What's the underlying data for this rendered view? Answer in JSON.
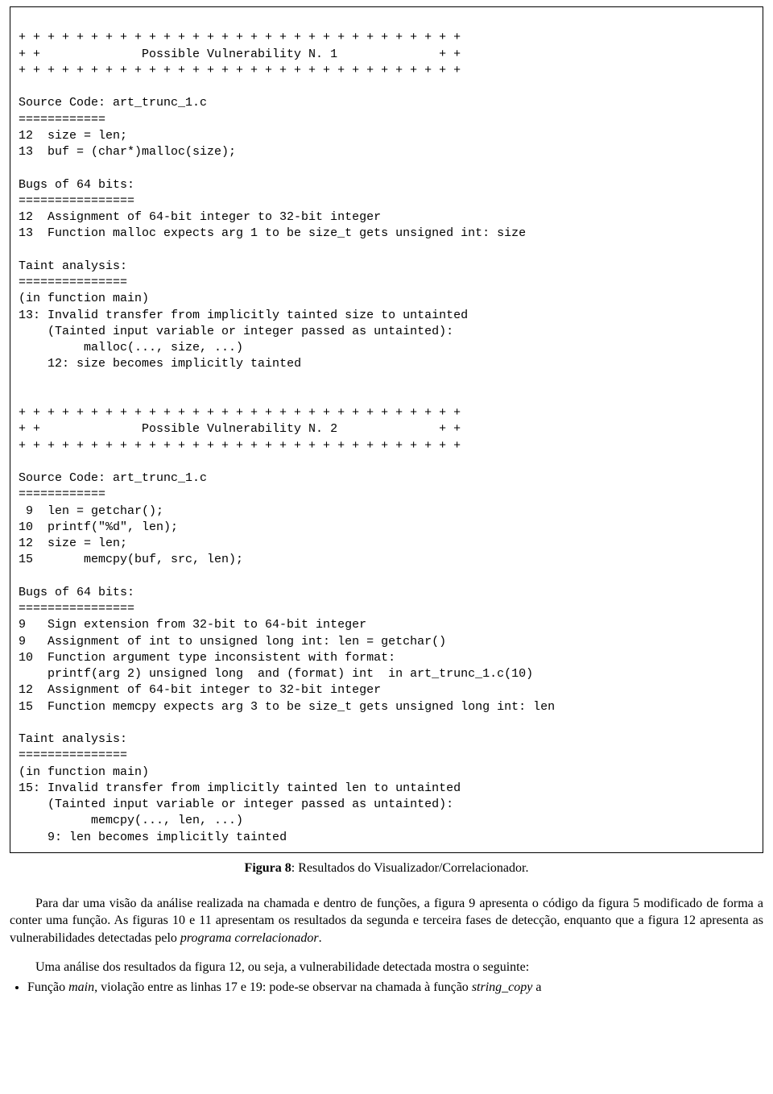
{
  "box": {
    "vuln1": {
      "border_top": "+ + + + + + + + + + + + + + + + + + + + + + + + + + + + + + +",
      "title_line": "+ +              Possible Vulnerability N. 1              + +",
      "border_bottom": "+ + + + + + + + + + + + + + + + + + + + + + + + + + + + + + +",
      "source_heading": "Source Code: art_trunc_1.c",
      "source_rule": "============",
      "source_lines": [
        "12  size = len;",
        "13  buf = (char*)malloc(size);"
      ],
      "bugs_heading": "Bugs of 64 bits:",
      "bugs_rule": "================",
      "bugs_lines": [
        "12  Assignment of 64-bit integer to 32-bit integer",
        "13  Function malloc expects arg 1 to be size_t gets unsigned int: size"
      ],
      "taint_heading": "Taint analysis:",
      "taint_rule": "===============",
      "taint_lines": [
        "(in function main)",
        "13: Invalid transfer from implicitly tainted size to untainted",
        "    (Tainted input variable or integer passed as untainted):",
        "         malloc(..., size, ...)",
        "    12: size becomes implicitly tainted"
      ]
    },
    "vuln2": {
      "border_top": "+ + + + + + + + + + + + + + + + + + + + + + + + + + + + + + +",
      "title_line": "+ +              Possible Vulnerability N. 2              + +",
      "border_bottom": "+ + + + + + + + + + + + + + + + + + + + + + + + + + + + + + +",
      "source_heading": "Source Code: art_trunc_1.c",
      "source_rule": "============",
      "source_lines": [
        " 9  len = getchar();",
        "10  printf(\"%d\", len);",
        "12  size = len;",
        "15       memcpy(buf, src, len);"
      ],
      "bugs_heading": "Bugs of 64 bits:",
      "bugs_rule": "================",
      "bugs_lines": [
        "9   Sign extension from 32-bit to 64-bit integer",
        "9   Assignment of int to unsigned long int: len = getchar()",
        "10  Function argument type inconsistent with format:",
        "    printf(arg 2) unsigned long  and (format) int  in art_trunc_1.c(10)",
        "12  Assignment of 64-bit integer to 32-bit integer",
        "15  Function memcpy expects arg 3 to be size_t gets unsigned long int: len"
      ],
      "taint_heading": "Taint analysis:",
      "taint_rule": "===============",
      "taint_lines": [
        "(in function main)",
        "15: Invalid transfer from implicitly tainted len to untainted",
        "    (Tainted input variable or integer passed as untainted):",
        "          memcpy(..., len, ...)",
        "    9: len becomes implicitly tainted"
      ]
    }
  },
  "caption": {
    "label": "Figura 8",
    "text": ": Resultados do Visualizador/Correlacionador."
  },
  "paragraph1": {
    "text_a": "Para dar uma visão da análise realizada na chamada e dentro de funções, a figura 9 apresenta o código da figura 5 modificado de forma a conter uma função. As figuras 10 e 11 apresentam os resultados da segunda e terceira fases de detecção, enquanto que a figura 12 apresenta as vulnerabilidades detectadas pelo ",
    "italic1": "programa correlacionador",
    "text_b": "."
  },
  "paragraph2": {
    "text": "Uma análise dos resultados da figura 12, ou seja, a vulnerabilidade detectada mostra o seguinte:"
  },
  "bullet1": {
    "pre": "Função ",
    "italic1": "main",
    "mid": ", violação entre as linhas 17 e 19: pode-se observar na chamada à função ",
    "italic2": "string_copy",
    "post": " a"
  }
}
